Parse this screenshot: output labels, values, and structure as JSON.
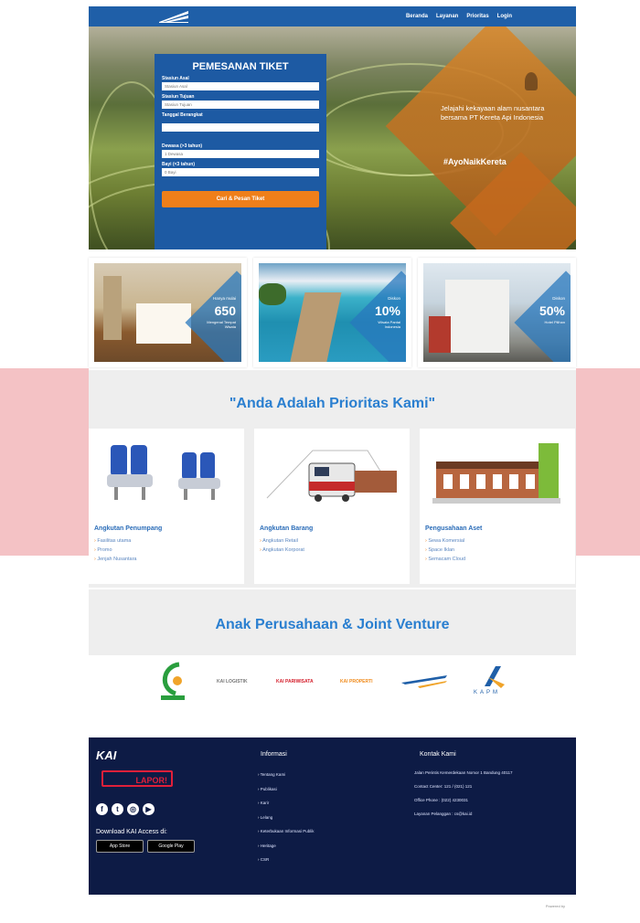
{
  "nav": {
    "links": [
      "Beranda",
      "Layanan",
      "Prioritas",
      "Login"
    ]
  },
  "hero": {
    "tagline": "Jelajahi kekayaan alam nusantara bersama PT Kereta Api Indonesia",
    "hashtag": "#AyoNaikKereta"
  },
  "form": {
    "title": "PEMESANAN TIKET",
    "origin_label": "Stasiun Asal",
    "origin_placeholder": "Stasiun Asal",
    "dest_label": "Stasiun Tujuan",
    "dest_placeholder": "Stasiun Tujuan",
    "date_label": "Tanggal Berangkat",
    "adult_label": "Dewasa (>3 tahun)",
    "adult_value": "1 Dewasa",
    "infant_label": "Bayi (<3 tahun)",
    "infant_value": "0 Bayi",
    "submit": "Cari & Pesan Tiket"
  },
  "promos": [
    {
      "pct": "650",
      "top": "Hanya mulai",
      "bottom": "Mengenal Tempat Wisata"
    },
    {
      "pct": "10%",
      "top": "Diskon",
      "bottom": "Wisata Pantai Indonesia"
    },
    {
      "pct": "50%",
      "top": "Diskon",
      "bottom": "Hotel Pilihan"
    }
  ],
  "priority": {
    "title": "\"Anda Adalah Prioritas Kami\"",
    "cards": [
      {
        "title": "Angkutan Penumpang",
        "items": [
          "Fasilitas utama",
          "Promo",
          "Jenjah Nusantara"
        ]
      },
      {
        "title": "Angkutan Barang",
        "items": [
          "Angkutan Retail",
          "Angkutan Korporat"
        ]
      },
      {
        "title": "Pengusahaan Aset",
        "items": [
          "Sewa Komersial",
          "Space Iklan",
          "Semacam Cloud"
        ]
      }
    ]
  },
  "anak": {
    "title": "Anak Perusahaan & Joint Venture"
  },
  "subsidiaries": [
    "KAI COMMUTER",
    "KAI LOGISTIK",
    "KAI PARIWISATA",
    "KAI PROPERTI",
    "RAILINK",
    "KAPM"
  ],
  "footer": {
    "brand": "KAI",
    "lapor": "LAPOR!",
    "download": "Download KAI Access di:",
    "appstore": "App Store",
    "googleplay": "Google Play",
    "info_title": "Informasi",
    "info_items": [
      "Tentang Kami",
      "Publikasi",
      "Karir",
      "Lelang",
      "Keterbukaan Informasi Publik",
      "Heritage",
      "CSR"
    ],
    "contact_title": "Kontak Kami",
    "contact_items": [
      "Jalan Perintis Kemerdekaan Nomor 1 Bandung 40117",
      "Contact Center: 121 / (021) 121",
      "Office Phone : (022) 4230031",
      "Layanan Pelanggan : cs@kai.id"
    ],
    "powered": "Powered by"
  },
  "colors": {
    "primary": "#1f5fa8",
    "accent": "#ef7f1a",
    "footer": "#0d1b45",
    "band": "#f4c2c5"
  }
}
